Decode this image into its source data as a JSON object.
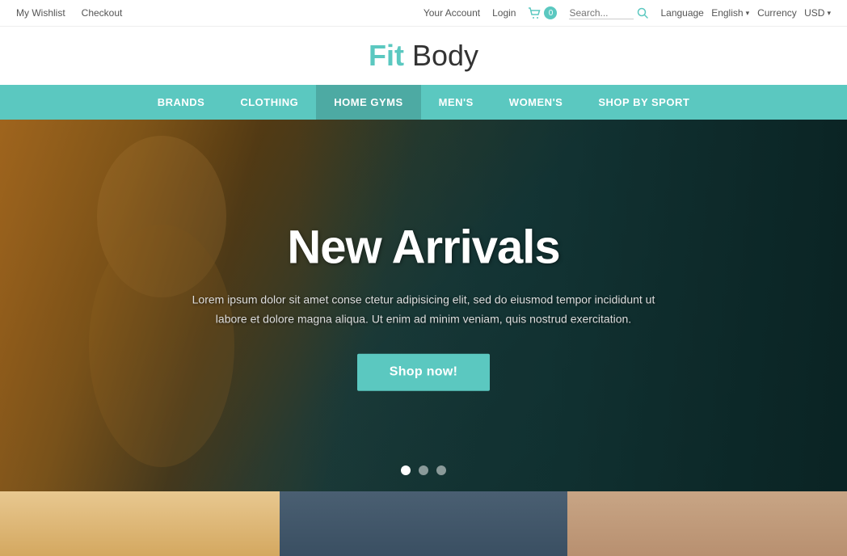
{
  "topbar": {
    "left": {
      "wishlist": "My Wishlist",
      "checkout": "Checkout"
    },
    "right": {
      "account": "Your Account",
      "login": "Login",
      "cart_count": "0",
      "search_placeholder": "Search...",
      "language_label": "Language",
      "language_value": "English",
      "currency_label": "Currency",
      "currency_value": "USD"
    }
  },
  "logo": {
    "fit": "Fit",
    "body": " Body"
  },
  "nav": {
    "items": [
      {
        "label": "BRANDS",
        "active": false
      },
      {
        "label": "CLOTHING",
        "active": false
      },
      {
        "label": "HOME GYMS",
        "active": true
      },
      {
        "label": "MEN'S",
        "active": false
      },
      {
        "label": "WOMEN'S",
        "active": false
      },
      {
        "label": "SHOP BY SPORT",
        "active": false
      }
    ]
  },
  "hero": {
    "title": "New Arrivals",
    "description": "Lorem ipsum dolor sit amet conse ctetur adipisicing elit, sed do eiusmod tempor incididunt ut labore et dolore magna aliqua. Ut enim ad minim veniam, quis nostrud exercitation.",
    "button_label": "Shop now!",
    "dots": [
      {
        "active": true
      },
      {
        "active": false
      },
      {
        "active": false
      }
    ]
  }
}
